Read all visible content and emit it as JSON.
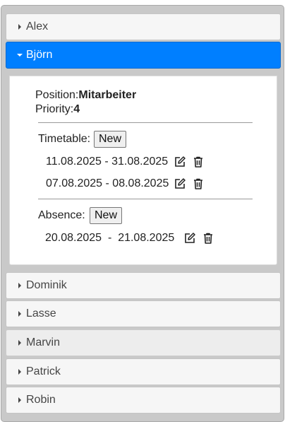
{
  "people": [
    {
      "name": "Alex",
      "expanded": false
    },
    {
      "name": "Björn",
      "expanded": true
    },
    {
      "name": "Dominik",
      "expanded": false
    },
    {
      "name": "Lasse",
      "expanded": false
    },
    {
      "name": "Marvin",
      "expanded": false
    },
    {
      "name": "Patrick",
      "expanded": false
    },
    {
      "name": "Robin",
      "expanded": false
    }
  ],
  "detail": {
    "position_label": "Position:",
    "position_value": "Mitarbeiter",
    "priority_label": "Priority:",
    "priority_value": "4",
    "timetable_label": "Timetable:",
    "timetable_new": "New",
    "timetables": [
      {
        "range": "11.08.2025 - 31.08.2025"
      },
      {
        "range": "07.08.2025 - 08.08.2025"
      }
    ],
    "absence_label": "Absence:",
    "absence_new": "New",
    "absences": [
      {
        "range": "20.08.2025  -  21.08.2025"
      }
    ]
  },
  "colors": {
    "active_header": "#007fff",
    "header_bg": "#f6f6f6"
  },
  "icons": {
    "edit": "edit-icon",
    "delete": "trash-icon"
  }
}
